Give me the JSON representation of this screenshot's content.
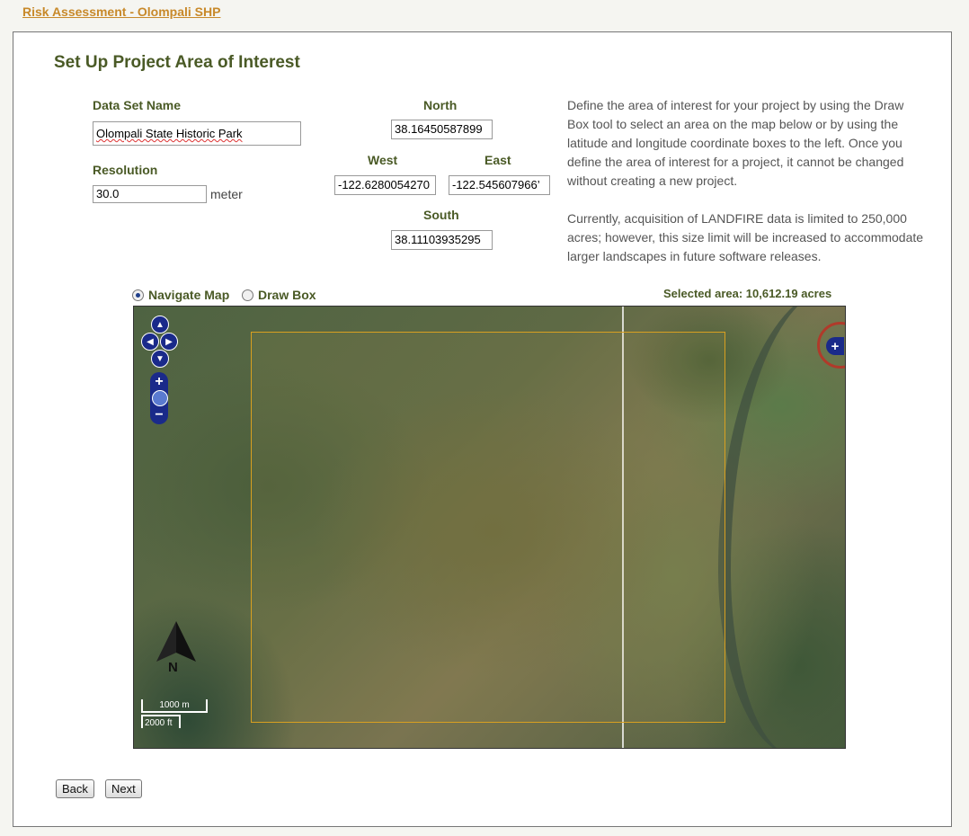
{
  "breadcrumb": "Risk Assessment - Olompali SHP",
  "page_title": "Set Up Project Area of Interest",
  "dataset": {
    "label": "Data Set Name",
    "value": "Olompali State Historic Park"
  },
  "resolution": {
    "label": "Resolution",
    "value": "30.0",
    "unit": "meter"
  },
  "coords": {
    "north_label": "North",
    "north_value": "38.16450587899",
    "west_label": "West",
    "west_value": "-122.6280054270",
    "east_label": "East",
    "east_value": "-122.545607966’",
    "south_label": "South",
    "south_value": "38.11103935295"
  },
  "description": {
    "p1": "Define the area of interest for your project by using the Draw Box tool to select an area on the map below or by using the latitude and longitude coordinate boxes to the left. Once you define the area of interest for a project, it cannot be changed without creating a new project.",
    "p2": "Currently, acquisition of LANDFIRE data is limited to 250,000 acres; however, this size limit will be increased to accommodate larger landscapes in future software releases."
  },
  "map_mode": {
    "navigate_label": "Navigate Map",
    "draw_label": "Draw Box",
    "selected": "navigate"
  },
  "selected_area": "Selected area: 10,612.19 acres",
  "map": {
    "compass_label": "N",
    "scale_top": "1000 m",
    "scale_bottom": "2000 ft",
    "icons": [
      "pan-up-icon",
      "pan-left-icon",
      "pan-right-icon",
      "pan-down-icon",
      "zoom-in-icon",
      "zoom-world-icon",
      "zoom-out-icon",
      "expand-layers-icon",
      "north-arrow-icon"
    ]
  },
  "buttons": {
    "back": "Back",
    "next": "Next"
  },
  "colors": {
    "heading": "#4a5a26",
    "link": "#c8892a",
    "nav_control": "#1a2a8a",
    "selection_box": "#d9a020",
    "highlight_circle": "#b03a2a"
  }
}
